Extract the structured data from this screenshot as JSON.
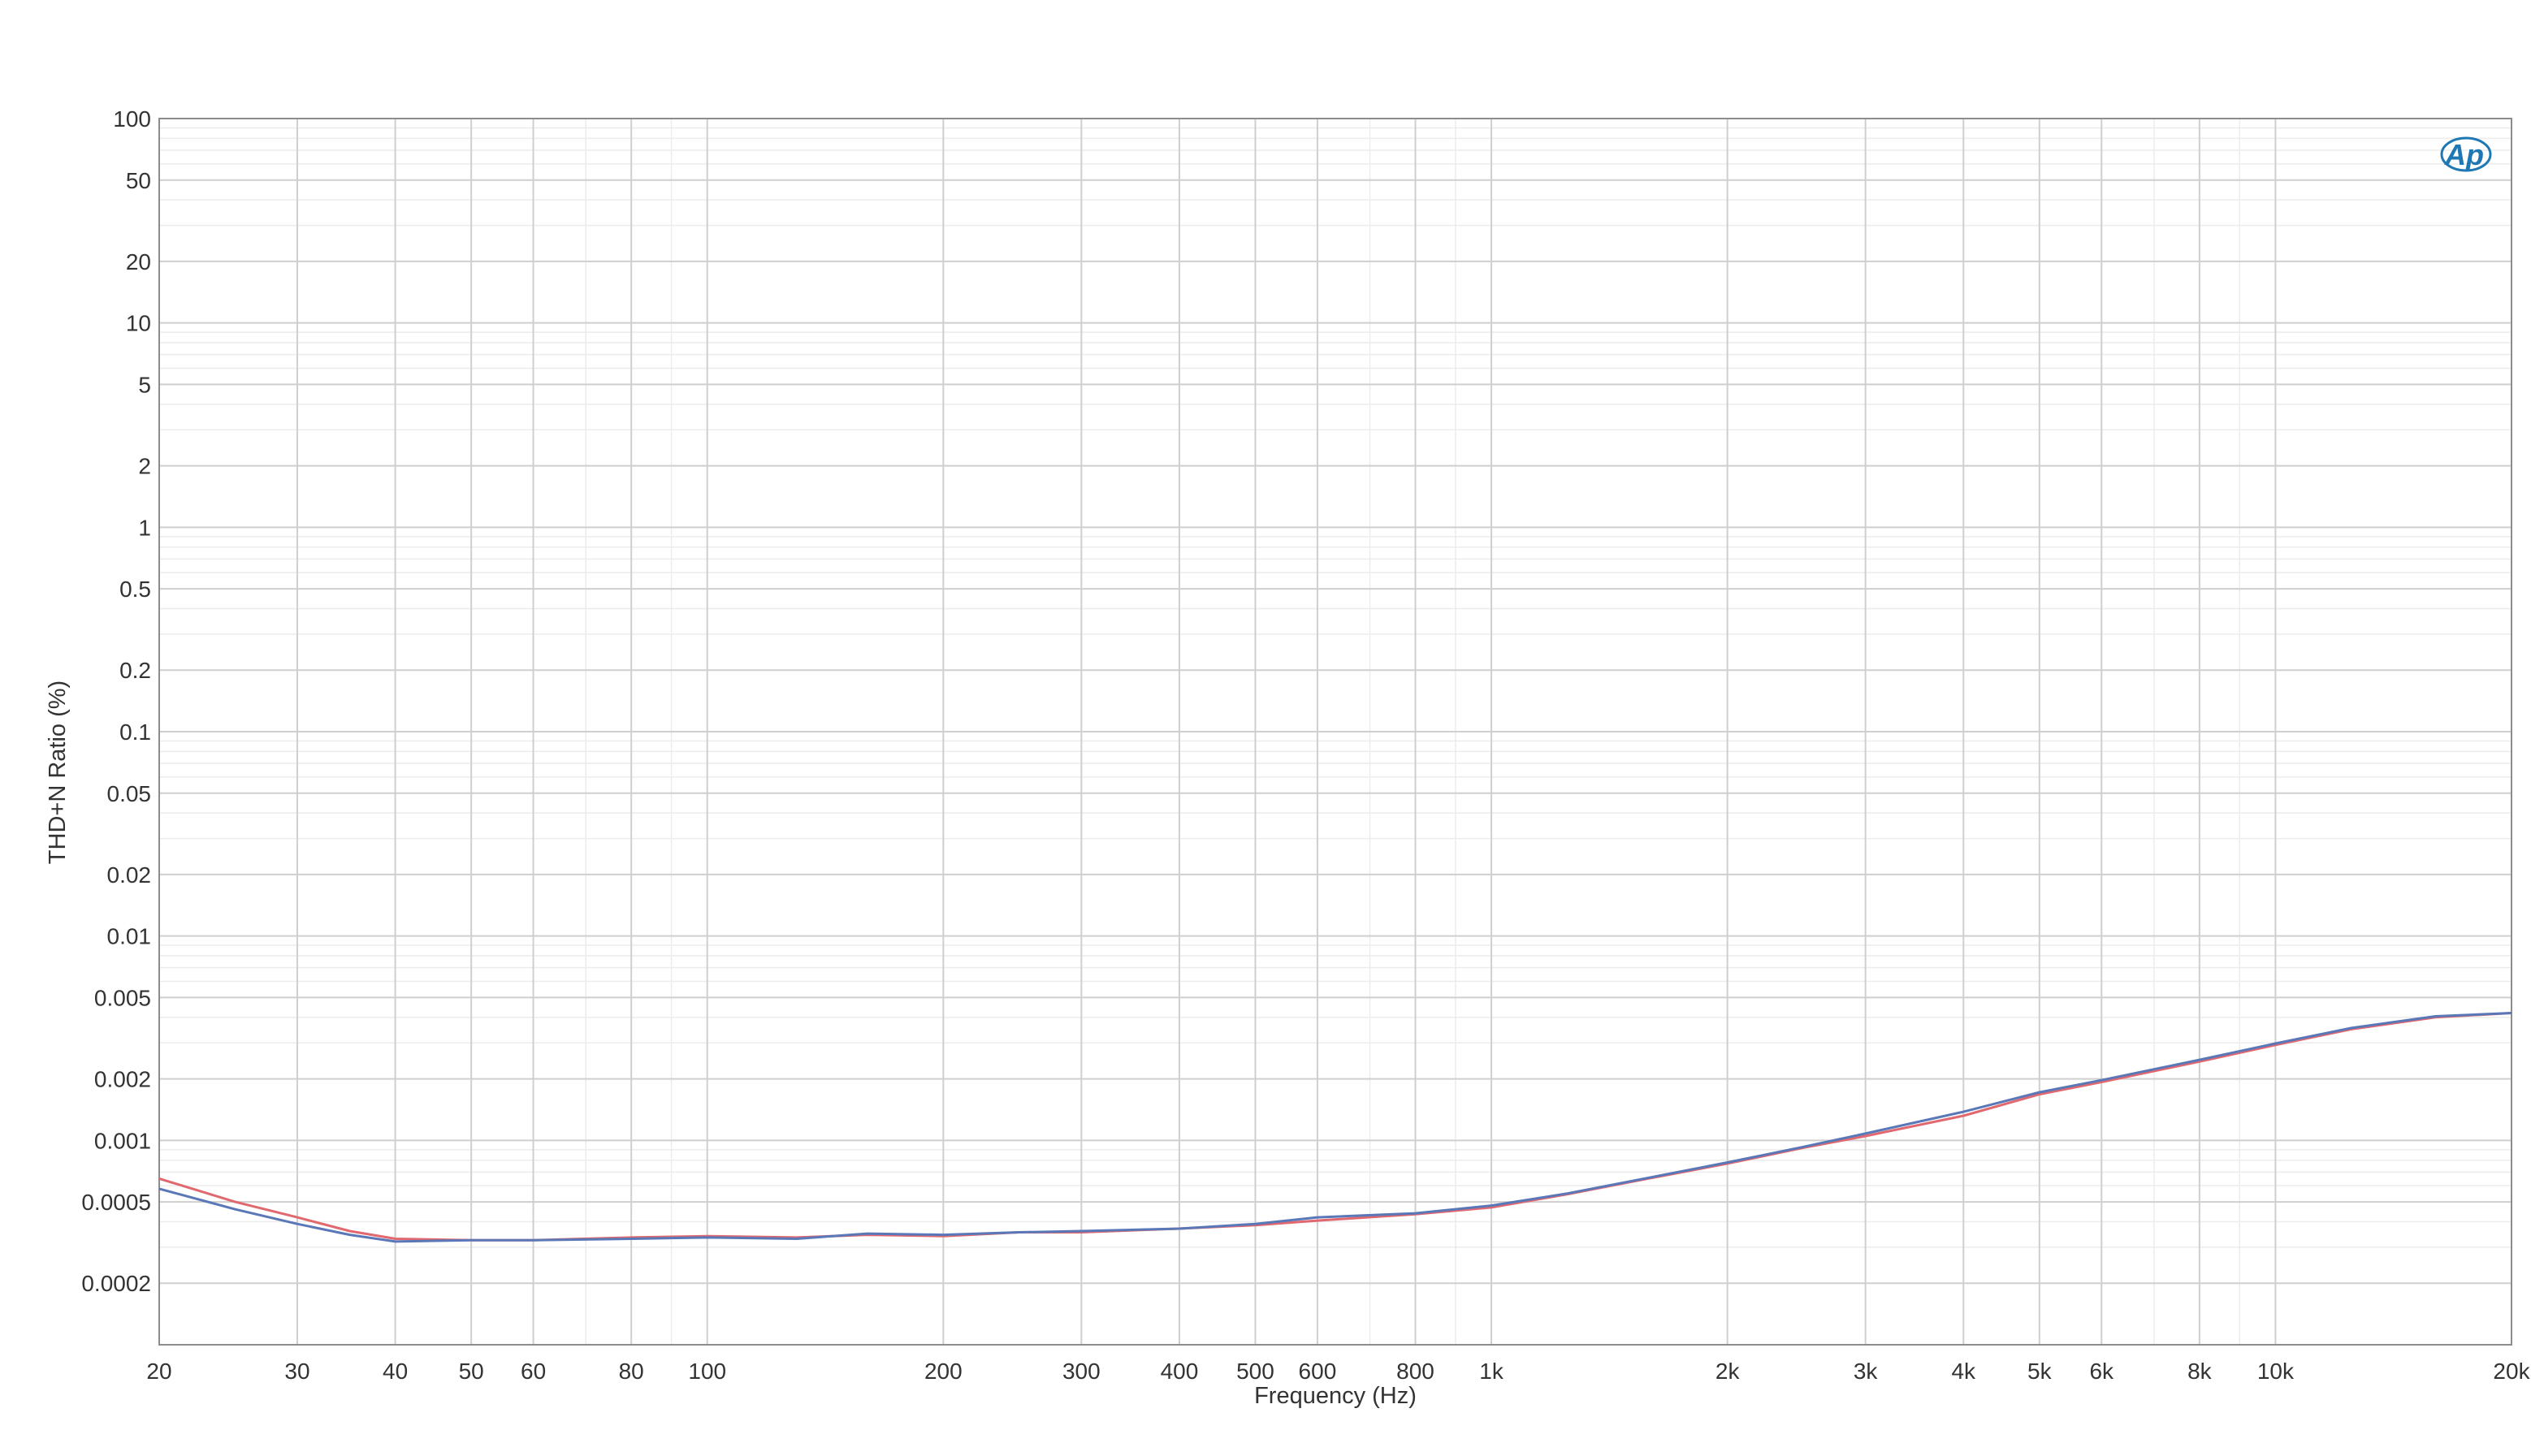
{
  "chart_data": {
    "type": "line",
    "xlabel": "Frequency (Hz)",
    "ylabel": "THD+N Ratio (%)",
    "x_scale": "log",
    "y_scale": "log",
    "xlim": [
      20,
      20000
    ],
    "ylim": [
      0.0001,
      100
    ],
    "grid": true,
    "x_ticks": [
      {
        "value": 20,
        "label": "20"
      },
      {
        "value": 30,
        "label": "30"
      },
      {
        "value": 40,
        "label": "40"
      },
      {
        "value": 50,
        "label": "50"
      },
      {
        "value": 60,
        "label": "60"
      },
      {
        "value": 80,
        "label": "80"
      },
      {
        "value": 100,
        "label": "100"
      },
      {
        "value": 200,
        "label": "200"
      },
      {
        "value": 300,
        "label": "300"
      },
      {
        "value": 400,
        "label": "400"
      },
      {
        "value": 500,
        "label": "500"
      },
      {
        "value": 600,
        "label": "600"
      },
      {
        "value": 800,
        "label": "800"
      },
      {
        "value": 1000,
        "label": "1k"
      },
      {
        "value": 2000,
        "label": "2k"
      },
      {
        "value": 3000,
        "label": "3k"
      },
      {
        "value": 4000,
        "label": "4k"
      },
      {
        "value": 5000,
        "label": "5k"
      },
      {
        "value": 6000,
        "label": "6k"
      },
      {
        "value": 8000,
        "label": "8k"
      },
      {
        "value": 10000,
        "label": "10k"
      },
      {
        "value": 20000,
        "label": "20k"
      }
    ],
    "y_ticks": [
      {
        "value": 100,
        "label": "100"
      },
      {
        "value": 50,
        "label": "50"
      },
      {
        "value": 20,
        "label": "20"
      },
      {
        "value": 10,
        "label": "10"
      },
      {
        "value": 5,
        "label": "5"
      },
      {
        "value": 2,
        "label": "2"
      },
      {
        "value": 1,
        "label": "1"
      },
      {
        "value": 0.5,
        "label": "0.5"
      },
      {
        "value": 0.2,
        "label": "0.2"
      },
      {
        "value": 0.1,
        "label": "0.1"
      },
      {
        "value": 0.05,
        "label": "0.05"
      },
      {
        "value": 0.02,
        "label": "0.02"
      },
      {
        "value": 0.01,
        "label": "0.01"
      },
      {
        "value": 0.005,
        "label": "0.005"
      },
      {
        "value": 0.002,
        "label": "0.002"
      },
      {
        "value": 0.001,
        "label": "0.001"
      },
      {
        "value": 0.0005,
        "label": "0.0005"
      },
      {
        "value": 0.0002,
        "label": "0.0002"
      }
    ],
    "x": [
      20,
      25,
      30,
      35,
      40,
      50,
      60,
      80,
      100,
      130,
      160,
      200,
      250,
      300,
      400,
      500,
      600,
      800,
      1000,
      1250,
      1600,
      2000,
      2500,
      3000,
      4000,
      5000,
      6000,
      8000,
      10000,
      12500,
      16000,
      20000
    ],
    "series": [
      {
        "color": "#5a78b8",
        "values": [
          0.00058,
          0.00046,
          0.00039,
          0.000345,
          0.00032,
          0.000325,
          0.000325,
          0.00033,
          0.000335,
          0.00033,
          0.00035,
          0.000345,
          0.000355,
          0.00036,
          0.00037,
          0.00039,
          0.00042,
          0.00044,
          0.00048,
          0.00055,
          0.00066,
          0.00078,
          0.00093,
          0.00108,
          0.00138,
          0.00172,
          0.00197,
          0.00248,
          0.00298,
          0.00355,
          0.00405,
          0.0042
        ]
      },
      {
        "color": "#e0686e",
        "values": [
          0.00065,
          0.0005,
          0.00042,
          0.00036,
          0.00033,
          0.000325,
          0.000325,
          0.000335,
          0.00034,
          0.000335,
          0.000345,
          0.00034,
          0.000355,
          0.000355,
          0.00037,
          0.000385,
          0.000405,
          0.000435,
          0.00047,
          0.000545,
          0.000655,
          0.00077,
          0.00092,
          0.00105,
          0.00132,
          0.00168,
          0.00193,
          0.00243,
          0.00293,
          0.0035,
          0.004,
          0.0042
        ]
      }
    ]
  },
  "logo": {
    "text": "Ap"
  }
}
